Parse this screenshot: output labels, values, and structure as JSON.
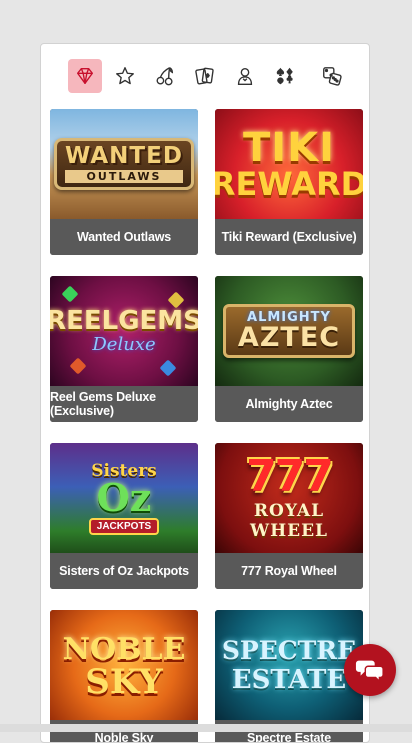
{
  "categories": [
    {
      "id": "featured",
      "icon": "diamond-icon",
      "active": true
    },
    {
      "id": "favourites",
      "icon": "star-icon",
      "active": false
    },
    {
      "id": "slots",
      "icon": "cherries-icon",
      "active": false
    },
    {
      "id": "cards",
      "icon": "playing-cards-icon",
      "active": false
    },
    {
      "id": "live",
      "icon": "dealer-icon",
      "active": false
    },
    {
      "id": "table",
      "icon": "card-suits-icon",
      "active": false
    },
    {
      "id": "dice",
      "icon": "dice-icon",
      "active": false
    }
  ],
  "games": [
    {
      "title": "Wanted Outlaws",
      "logo": [
        "WANTED",
        "OUTLAWS"
      ]
    },
    {
      "title": "Tiki Reward (Exclusive)",
      "logo": [
        "TIKI",
        "REWARD"
      ]
    },
    {
      "title": "Reel Gems Deluxe (Exclusive)",
      "logo": [
        "REELGEMS",
        "Deluxe"
      ]
    },
    {
      "title": "Almighty Aztec",
      "logo": [
        "ALMIGHTY",
        "AZTEC"
      ]
    },
    {
      "title": "Sisters of Oz Jackpots",
      "logo": [
        "Sisters",
        "Oz",
        "JACKPOTS"
      ]
    },
    {
      "title": "777 Royal Wheel",
      "logo": [
        "777",
        "ROYAL WHEEL"
      ]
    },
    {
      "title": "Noble Sky",
      "logo": [
        "NOBLE",
        "SKY"
      ]
    },
    {
      "title": "Spectre Estate",
      "logo": [
        "SPECTRE",
        "ESTATE"
      ]
    }
  ],
  "chat": {
    "icon": "chat-bubbles-icon"
  },
  "colors": {
    "accent": "#c8102e",
    "active_tab_bg": "#f6b7bd",
    "caption_bg": "#595959",
    "chat_button": "#b3121f"
  }
}
